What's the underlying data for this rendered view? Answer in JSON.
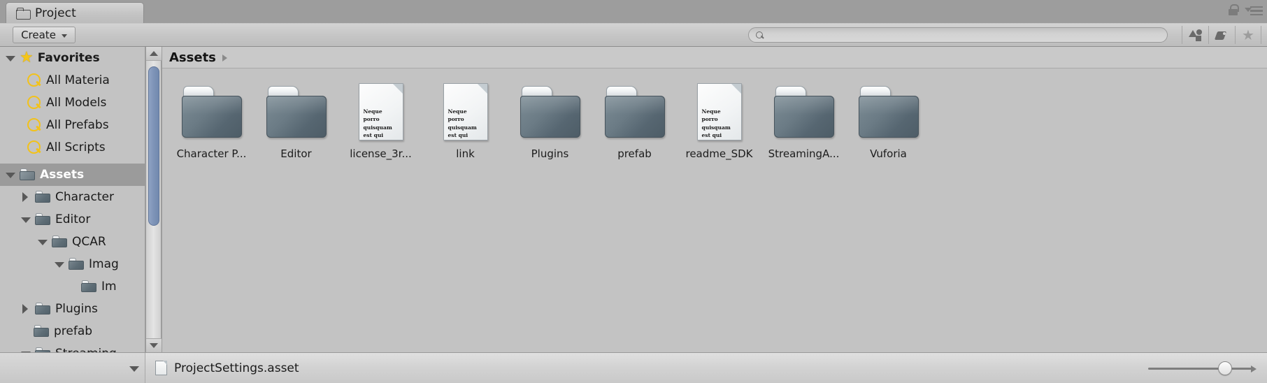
{
  "window": {
    "tab_label": "Project",
    "tab_icon": "folder-outline-icon",
    "lock_icon": "lock-icon",
    "menu_icon": "hamburger-menu-icon"
  },
  "toolbar": {
    "create_label": "Create",
    "create_caret_icon": "caret-down-icon",
    "search": {
      "value": "",
      "placeholder": "",
      "icon": "search-icon"
    },
    "filters": [
      {
        "name": "type-filter",
        "icon": "shapes-icon"
      },
      {
        "name": "label-filter",
        "icon": "tag-icon"
      },
      {
        "name": "favorite-filter",
        "icon": "star-icon",
        "glyph": "★"
      }
    ]
  },
  "sidebar": {
    "favorites": {
      "label": "Favorites",
      "icon": "star-icon",
      "expanded": true,
      "items": [
        {
          "label": "All Materia",
          "icon": "magnifier-icon"
        },
        {
          "label": "All Models",
          "icon": "magnifier-icon"
        },
        {
          "label": "All Prefabs",
          "icon": "magnifier-icon"
        },
        {
          "label": "All Scripts",
          "icon": "magnifier-icon"
        }
      ]
    },
    "assets": {
      "label": "Assets",
      "icon": "folder-icon",
      "expanded": true,
      "selected": true,
      "items": [
        {
          "label": "Character",
          "icon": "folder-icon",
          "expanded": false,
          "indent": 1
        },
        {
          "label": "Editor",
          "icon": "folder-icon",
          "expanded": true,
          "indent": 1
        },
        {
          "label": "QCAR",
          "icon": "folder-icon",
          "expanded": true,
          "indent": 2
        },
        {
          "label": "Imag",
          "icon": "folder-icon",
          "expanded": true,
          "indent": 3
        },
        {
          "label": "Im",
          "icon": "folder-icon",
          "expanded": null,
          "indent": 4
        },
        {
          "label": "Plugins",
          "icon": "folder-icon",
          "expanded": false,
          "indent": 1
        },
        {
          "label": "prefab",
          "icon": "folder-icon",
          "expanded": null,
          "indent": 1
        },
        {
          "label": "Streaming",
          "icon": "folder-icon",
          "expanded": true,
          "indent": 1
        }
      ]
    },
    "scrollbar": {
      "up_icon": "scroll-up-arrow-icon",
      "down_icon": "scroll-down-arrow-icon"
    }
  },
  "main": {
    "breadcrumb": {
      "root": "Assets",
      "arrow_icon": "breadcrumb-arrow-icon"
    },
    "doc_preview_text": "Neque porro quisquam est qui dolorem.",
    "assets": [
      {
        "label": "Character P...",
        "type": "folder"
      },
      {
        "label": "Editor",
        "type": "folder"
      },
      {
        "label": "license_3r...",
        "type": "document"
      },
      {
        "label": "link",
        "type": "document"
      },
      {
        "label": "Plugins",
        "type": "folder"
      },
      {
        "label": "prefab",
        "type": "folder"
      },
      {
        "label": "readme_SDK",
        "type": "document"
      },
      {
        "label": "StreamingA...",
        "type": "folder"
      },
      {
        "label": "Vuforia",
        "type": "folder"
      }
    ]
  },
  "statusbar": {
    "selection_label": "ProjectSettings.asset",
    "selection_icon": "document-icon",
    "collapse_icon": "triangle-down-icon",
    "zoom": {
      "value": 78
    }
  },
  "colors": {
    "window_bg": "#9d9d9d",
    "panel_bg": "#c3c3c3",
    "toolbar_bg": "#c6c6c6",
    "selection_bg": "#9b9b9b",
    "folder_blue": "#5e6d76",
    "favorite_yellow": "#f2c21a",
    "scroll_thumb_blue": "#7f94b8"
  }
}
